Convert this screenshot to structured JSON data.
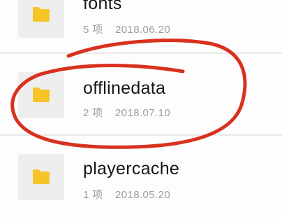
{
  "file_list": {
    "items": [
      {
        "name": "fonts",
        "count": "5 项",
        "date": "2018.06.20"
      },
      {
        "name": "offlinedata",
        "count": "2 项",
        "date": "2018.07.10"
      },
      {
        "name": "playercache",
        "count": "1 项",
        "date": "2018.05.20"
      }
    ]
  },
  "colors": {
    "folder_icon": "#f6c427",
    "icon_background": "#eeeeee",
    "annotation_circle": "#d8321f"
  }
}
